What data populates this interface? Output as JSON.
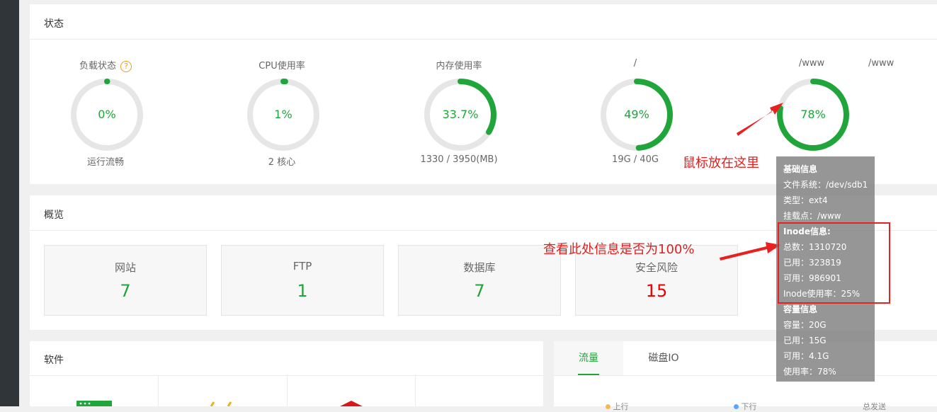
{
  "status": {
    "title": "状态",
    "gauges": [
      {
        "label": "负载状态",
        "value": "0%",
        "percent": 0,
        "sub": "运行流畅",
        "help": "?"
      },
      {
        "label": "CPU使用率",
        "value": "1%",
        "percent": 1,
        "sub": "2 核心"
      },
      {
        "label": "内存使用率",
        "value": "33.7%",
        "percent": 33.7,
        "sub": "1330 / 3950(MB)"
      },
      {
        "label": "/",
        "value": "49%",
        "percent": 49,
        "sub": "19G / 40G"
      },
      {
        "label": "/www",
        "value": "78%",
        "percent": 78,
        "sub": ""
      },
      {
        "label": "/www",
        "value": "",
        "percent": null,
        "sub": ""
      }
    ]
  },
  "overview": {
    "title": "概览",
    "cards": [
      {
        "name": "网站",
        "value": "7"
      },
      {
        "name": "FTP",
        "value": "1"
      },
      {
        "name": "数据库",
        "value": "7"
      },
      {
        "name": "安全风险",
        "value": "15"
      }
    ]
  },
  "software": {
    "title": "软件"
  },
  "traffic": {
    "tabs": [
      "流量",
      "磁盘IO"
    ],
    "legend": [
      "上行",
      "下行",
      "总发送"
    ]
  },
  "tooltip": {
    "lines": [
      {
        "text": "基础信息",
        "head": true
      },
      {
        "text": "文件系统：/dev/sdb1"
      },
      {
        "text": "类型：ext4"
      },
      {
        "text": "挂载点：/www"
      },
      {
        "text": "Inode信息:",
        "head": true
      },
      {
        "text": "总数：1310720"
      },
      {
        "text": "已用：323819"
      },
      {
        "text": "可用：986901"
      },
      {
        "text": "Inode使用率：25%"
      },
      {
        "text": "容量信息",
        "head": true
      },
      {
        "text": "容量：20G"
      },
      {
        "text": "已用：15G"
      },
      {
        "text": "可用：4.1G"
      },
      {
        "text": "使用率：78%"
      }
    ]
  },
  "annotations": {
    "hover_hint": "鼠标放在这里",
    "check_hint": "查看此处信息是否为100%"
  },
  "colors": {
    "accent": "#20a53a",
    "track": "#e6e6e6",
    "risk": "#e00000",
    "annotation": "#e02020"
  }
}
